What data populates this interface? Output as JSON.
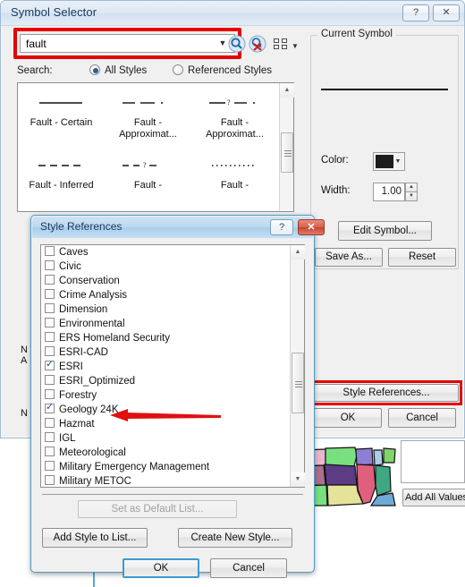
{
  "window": {
    "title": "Symbol Selector",
    "help_glyph": "?",
    "close_glyph": "✕"
  },
  "search": {
    "value": "fault",
    "placeholder": "",
    "dropdown_arrow": "▼",
    "search_icon": "search-icon",
    "clear_search_icon": "clear-search-icon",
    "view_style_icon": "view-style-icon",
    "view_style_arrow": "▼",
    "label": "Search:",
    "options": [
      {
        "label": "All Styles",
        "selected": true
      },
      {
        "label": "Referenced Styles",
        "selected": false
      }
    ]
  },
  "gallery": {
    "items": [
      {
        "label": "Fault - Certain",
        "style": "solid"
      },
      {
        "label": "Fault - Approximat...",
        "style": "dash-dot"
      },
      {
        "label": "Fault - Approximat...",
        "style": "dash-query"
      },
      {
        "label": "Fault - Inferred",
        "style": "dashed"
      },
      {
        "label": "Fault -",
        "style": "dashed-query"
      },
      {
        "label": "Fault -",
        "style": "dotted"
      }
    ],
    "occluded_labels": [
      "N",
      "A",
      "N"
    ],
    "scroll_up_arrow": "▲",
    "scroll_down_arrow": "▼"
  },
  "current_symbol": {
    "legend": "Current Symbol",
    "color_label": "Color:",
    "color_value": "#1c1c1c",
    "color_dropdown_arrow": "▼",
    "width_label": "Width:",
    "width_value": "1.00",
    "spin_up": "▲",
    "spin_down": "▼",
    "edit_symbol_label": "Edit Symbol...",
    "save_as_label": "Save As...",
    "reset_label": "Reset"
  },
  "window_buttons": {
    "style_references_label": "Style References...",
    "ok_label": "OK",
    "cancel_label": "Cancel"
  },
  "style_references_dialog": {
    "title": "Style References",
    "help_glyph": "?",
    "close_glyph": "✕",
    "items": [
      {
        "label": "Caves",
        "checked": false
      },
      {
        "label": "Civic",
        "checked": false
      },
      {
        "label": "Conservation",
        "checked": false
      },
      {
        "label": "Crime Analysis",
        "checked": false
      },
      {
        "label": "Dimension",
        "checked": false
      },
      {
        "label": "Environmental",
        "checked": false
      },
      {
        "label": "ERS Homeland Security",
        "checked": false
      },
      {
        "label": "ESRI-CAD",
        "checked": false
      },
      {
        "label": "ESRI",
        "checked": true
      },
      {
        "label": "ESRI_Optimized",
        "checked": false
      },
      {
        "label": "Forestry",
        "checked": false
      },
      {
        "label": "Geology 24K",
        "checked": true
      },
      {
        "label": "Hazmat",
        "checked": false
      },
      {
        "label": "IGL",
        "checked": false
      },
      {
        "label": "Meteorological",
        "checked": false
      },
      {
        "label": "Military Emergency Management",
        "checked": false
      },
      {
        "label": "Military METOC",
        "checked": false
      }
    ],
    "set_default_label": "Set as Default List...",
    "add_style_label": "Add Style to List...",
    "create_style_label": "Create New Style...",
    "ok_label": "OK",
    "cancel_label": "Cancel",
    "scroll_up_arrow": "▲",
    "scroll_down_arrow": "▼"
  },
  "background": {
    "add_all_values_label": "Add All Values",
    "map_states": [
      {
        "name": "south-dakota",
        "color": "#e9b6d0"
      },
      {
        "name": "minnesota",
        "color": "#79e07f"
      },
      {
        "name": "wisconsin",
        "color": "#8d7fd4"
      },
      {
        "name": "michigan-upper",
        "color": "#a9cdea"
      },
      {
        "name": "michigan-lower",
        "color": "#7fd46a"
      },
      {
        "name": "nebraska",
        "color": "#ad6f8e"
      },
      {
        "name": "iowa",
        "color": "#5b3c85"
      },
      {
        "name": "illinois",
        "color": "#e05f7e"
      },
      {
        "name": "indiana",
        "color": "#3fa883"
      },
      {
        "name": "kansas",
        "color": "#79e07f"
      },
      {
        "name": "missouri",
        "color": "#e5e39a"
      },
      {
        "name": "kentucky",
        "color": "#6fa9d6"
      }
    ]
  },
  "annotations": {
    "highlight_color": "#e60000",
    "arrow_color": "#e01010",
    "search_box_highlight": "search-field-highlight",
    "style_references_highlight": "style-references-button-highlight",
    "geology_arrow": "geology-24k-pointer-arrow"
  }
}
